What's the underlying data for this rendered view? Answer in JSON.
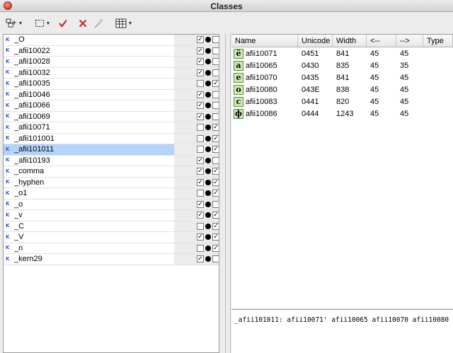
{
  "window": {
    "title": "Classes"
  },
  "toolbar": {
    "items": [
      "add-class-icon",
      "selection-icon",
      "check-icon",
      "delete-icon",
      "magic-icon",
      "table-view-icon"
    ]
  },
  "classes": [
    {
      "name": "_O",
      "c1": true,
      "c2": false
    },
    {
      "name": "_afii10022",
      "c1": true,
      "c2": false
    },
    {
      "name": "_afii10028",
      "c1": true,
      "c2": false
    },
    {
      "name": "_afii10032",
      "c1": true,
      "c2": false
    },
    {
      "name": "_afii10035",
      "c1": false,
      "c2": true
    },
    {
      "name": "_afii10046",
      "c1": true,
      "c2": false
    },
    {
      "name": "_afii10066",
      "c1": true,
      "c2": false
    },
    {
      "name": "_afii10069",
      "c1": true,
      "c2": false
    },
    {
      "name": "_afii10071",
      "c1": false,
      "c2": true
    },
    {
      "name": "_afii101001",
      "c1": false,
      "c2": true
    },
    {
      "name": "_afii101011",
      "c1": false,
      "c2": true,
      "selected": true
    },
    {
      "name": "_afii10193",
      "c1": true,
      "c2": false
    },
    {
      "name": "_comma",
      "c1": true,
      "c2": true
    },
    {
      "name": "_hyphen",
      "c1": true,
      "c2": true
    },
    {
      "name": "_o1",
      "c1": false,
      "c2": true
    },
    {
      "name": "_o",
      "c1": true,
      "c2": false
    },
    {
      "name": "_v",
      "c1": true,
      "c2": true
    },
    {
      "name": "_C",
      "c1": false,
      "c2": true
    },
    {
      "name": "_V",
      "c1": true,
      "c2": true
    },
    {
      "name": "_n",
      "c1": false,
      "c2": true
    },
    {
      "name": "_kern29",
      "c1": true,
      "c2": false
    }
  ],
  "glyph_table": {
    "headers": [
      "Name",
      "Unicode",
      "Width",
      "<--",
      "-->",
      "Type"
    ],
    "rows": [
      {
        "glyph": "ё",
        "name": "afii10071",
        "unicode": "0451",
        "width": "841",
        "left": "45",
        "right": "45"
      },
      {
        "glyph": "а",
        "name": "afii10065",
        "unicode": "0430",
        "width": "835",
        "left": "45",
        "right": "35"
      },
      {
        "glyph": "е",
        "name": "afii10070",
        "unicode": "0435",
        "width": "841",
        "left": "45",
        "right": "45"
      },
      {
        "glyph": "о",
        "name": "afii10080",
        "unicode": "043E",
        "width": "838",
        "left": "45",
        "right": "45"
      },
      {
        "glyph": "с",
        "name": "afii10083",
        "unicode": "0441",
        "width": "820",
        "left": "45",
        "right": "45"
      },
      {
        "glyph": "ф",
        "name": "afii10086",
        "unicode": "0444",
        "width": "1243",
        "left": "45",
        "right": "45"
      }
    ]
  },
  "definition": {
    "text": "_afii101011: afii10071' afii10065 afii10070 afii10080"
  }
}
